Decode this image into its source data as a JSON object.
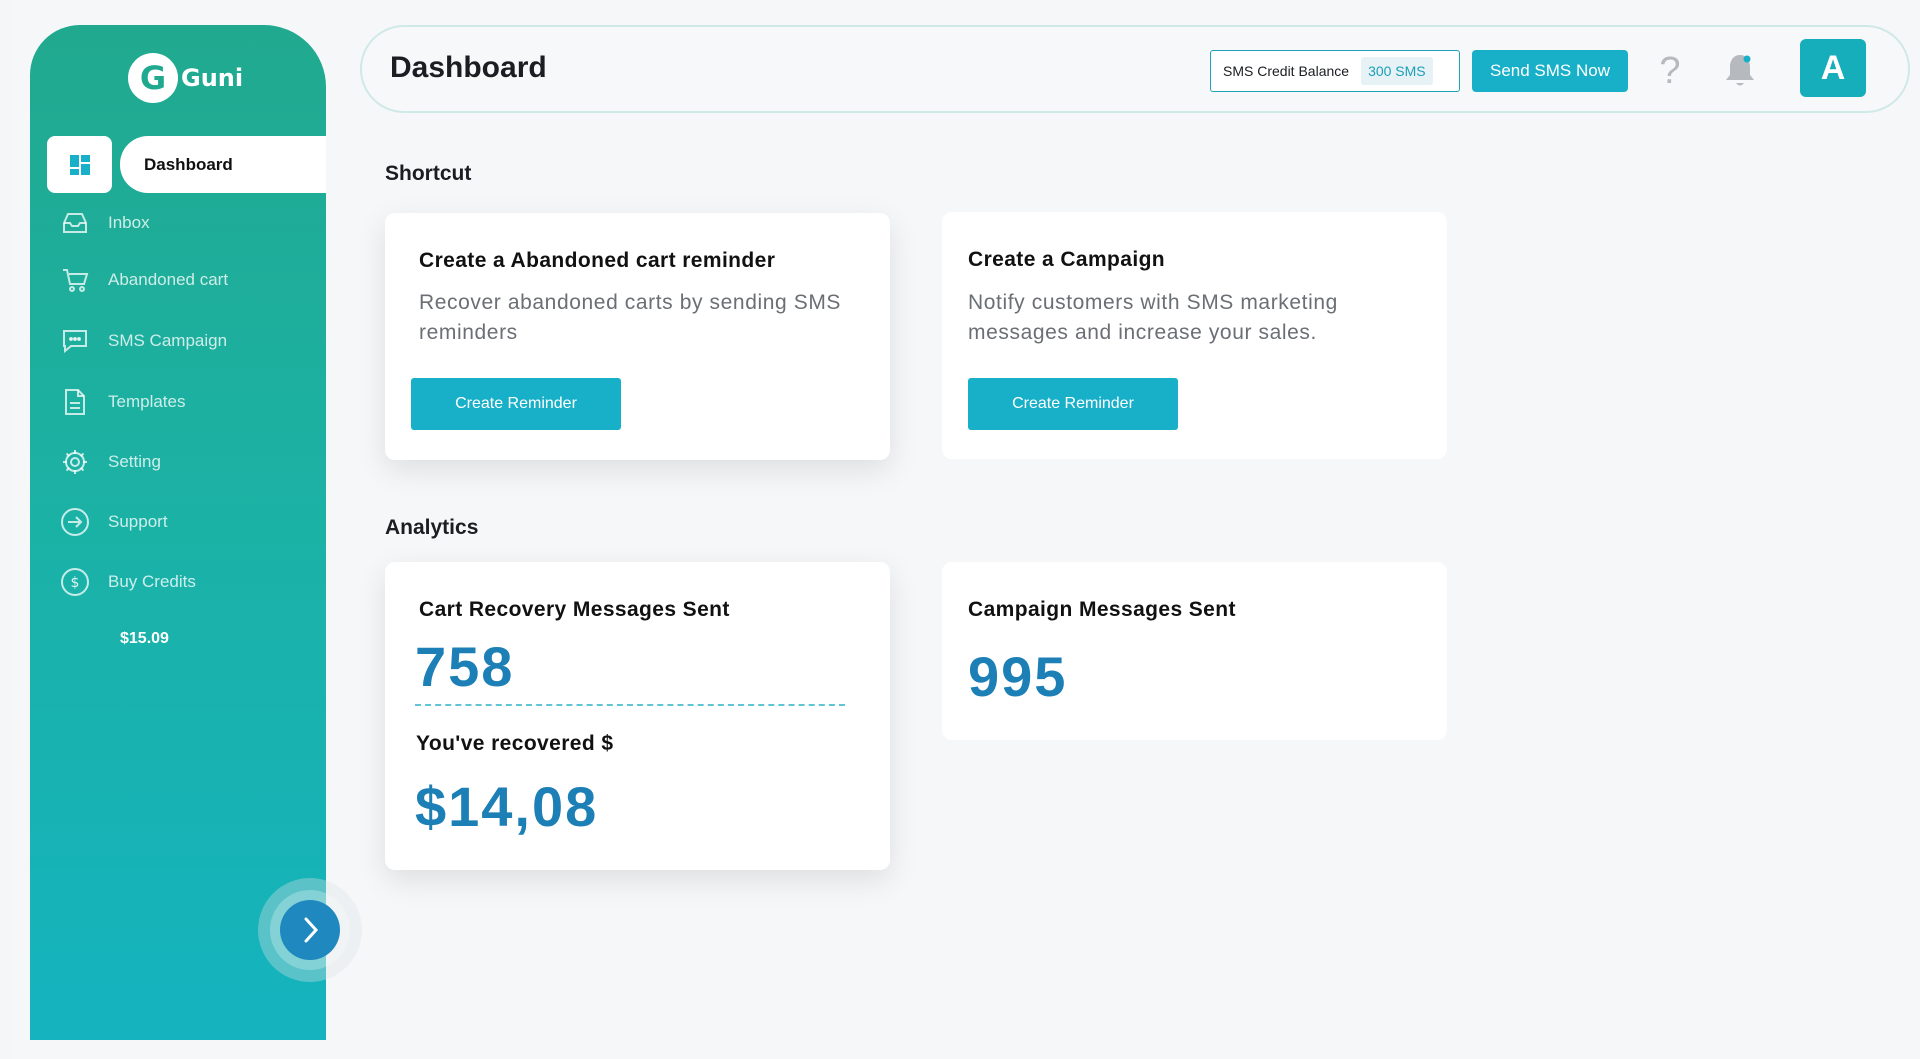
{
  "app": {
    "logo_letter": "G",
    "logo_text": "Guni"
  },
  "sidebar": {
    "active": {
      "label": "Dashboard",
      "icon": "dashboard-icon"
    },
    "items": [
      {
        "label": "Inbox",
        "icon": "inbox-icon"
      },
      {
        "label": "Abandoned cart",
        "icon": "cart-icon"
      },
      {
        "label": "SMS Campaign",
        "icon": "chat-icon"
      },
      {
        "label": "Templates",
        "icon": "document-icon"
      },
      {
        "label": "Setting",
        "icon": "gear-icon"
      },
      {
        "label": "Support",
        "icon": "arrow-circle-icon"
      },
      {
        "label": "Buy Credits",
        "icon": "dollar-icon"
      }
    ],
    "credits_value": "$15.09"
  },
  "header": {
    "title": "Dashboard",
    "credit_label": "SMS Credit Balance",
    "credit_value": "300 SMS",
    "send_button": "Send SMS Now",
    "help_glyph": "?",
    "avatar_letter": "A"
  },
  "shortcut": {
    "section_title": "Shortcut",
    "cards": [
      {
        "title": "Create a Abandoned cart reminder",
        "description": "Recover abandoned carts by sending SMS reminders",
        "button": "Create Reminder"
      },
      {
        "title": "Create a Campaign",
        "description": "Notify customers with SMS marketing messages and increase your sales.",
        "button": "Create Reminder"
      }
    ]
  },
  "analytics": {
    "section_title": "Analytics",
    "cart_recovery": {
      "title": "Cart Recovery Messages Sent",
      "value": "758",
      "recovered_label": "You've recovered $",
      "recovered_value": "$14,08"
    },
    "campaign": {
      "title": "Campaign Messages Sent",
      "value": "995"
    }
  },
  "colors": {
    "brand": "#17b0c8",
    "sidebar_top": "#21a98f",
    "sidebar_bottom": "#14b3bf",
    "numbers": "#1c7fb5"
  }
}
